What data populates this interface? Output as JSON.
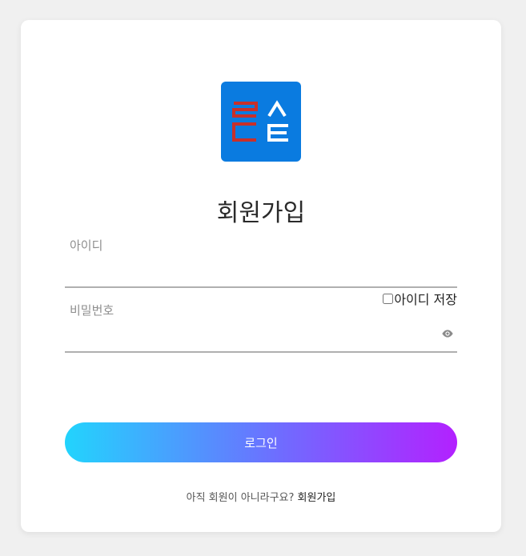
{
  "logo": {
    "bg_color": "#0a7be0",
    "accent_red": "#c8302a"
  },
  "page_title": "회원가입",
  "id_field": {
    "label": "아이디",
    "value": ""
  },
  "remember": {
    "label": "아이디 저장",
    "checked": false
  },
  "password_field": {
    "label": "비밀번호",
    "value": ""
  },
  "login_button": {
    "label": "로그인",
    "gradient": [
      "#22d4fd",
      "#6f6cff",
      "#b321ff"
    ]
  },
  "signup": {
    "prompt": "아직 회원이 아니라구요?",
    "link_label": "회원가입"
  }
}
